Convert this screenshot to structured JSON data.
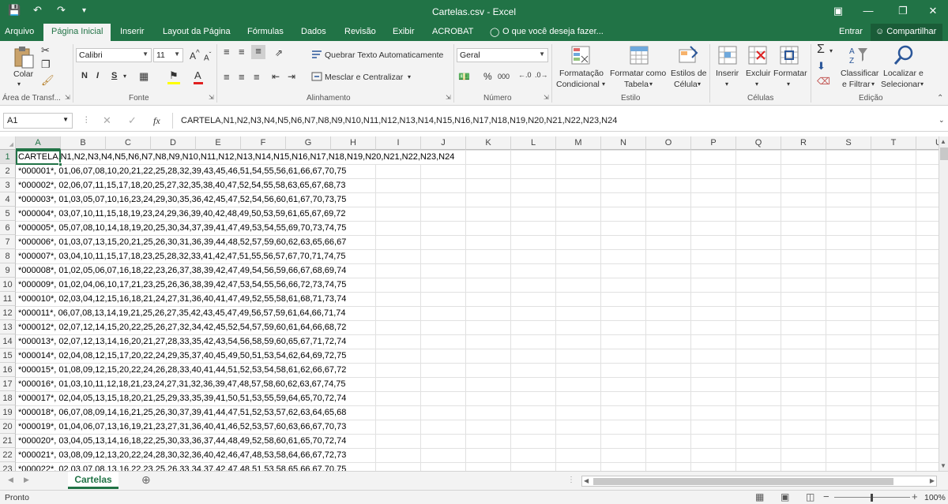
{
  "window": {
    "title": "Cartelas.csv - Excel"
  },
  "tabs": [
    "Arquivo",
    "Página Inicial",
    "Inserir",
    "Layout da Página",
    "Fórmulas",
    "Dados",
    "Revisão",
    "Exibir",
    "ACROBAT"
  ],
  "tell_me": "O que você deseja fazer...",
  "account": {
    "login": "Entrar",
    "share": "Compartilhar"
  },
  "ribbon": {
    "clipboard": {
      "paste": "Colar",
      "group": "Área de Transf..."
    },
    "font": {
      "name": "Calibri",
      "size": "11",
      "group": "Fonte",
      "bold": "N",
      "italic": "I",
      "underline": "S"
    },
    "alignment": {
      "wrap": "Quebrar Texto Automaticamente",
      "merge": "Mesclar e Centralizar",
      "group": "Alinhamento"
    },
    "number": {
      "format": "Geral",
      "group": "Número",
      "percent": "%",
      "thousands": "000"
    },
    "styles": {
      "conditional_1": "Formatação",
      "conditional_2": "Condicional",
      "table_1": "Formatar como",
      "table_2": "Tabela",
      "cell_1": "Estilos de",
      "cell_2": "Célula",
      "group": "Estilo"
    },
    "cells": {
      "insert": "Inserir",
      "delete": "Excluir",
      "format": "Formatar",
      "group": "Células"
    },
    "editing": {
      "sort_1": "Classificar",
      "sort_2": "e Filtrar",
      "find_1": "Localizar e",
      "find_2": "Selecionar",
      "group": "Edição"
    }
  },
  "formula_bar": {
    "name_box": "A1",
    "fx": "fx",
    "content": "CARTELA,N1,N2,N3,N4,N5,N6,N7,N8,N9,N10,N11,N12,N13,N14,N15,N16,N17,N18,N19,N20,N21,N22,N23,N24"
  },
  "columns": [
    "A",
    "B",
    "C",
    "D",
    "E",
    "F",
    "G",
    "H",
    "I",
    "J",
    "K",
    "L",
    "M",
    "N",
    "O",
    "P",
    "Q",
    "R",
    "S",
    "T",
    "U"
  ],
  "rows": [
    {
      "num": "1",
      "text": "CARTELA,N1,N2,N3,N4,N5,N6,N7,N8,N9,N10,N11,N12,N13,N14,N15,N16,N17,N18,N19,N20,N21,N22,N23,N24"
    },
    {
      "num": "2",
      "text": "*000001*, 01,06,07,08,10,20,21,22,25,28,32,39,43,45,46,51,54,55,56,61,66,67,70,75"
    },
    {
      "num": "3",
      "text": "*000002*, 02,06,07,11,15,17,18,20,25,27,32,35,38,40,47,52,54,55,58,63,65,67,68,73"
    },
    {
      "num": "4",
      "text": "*000003*, 01,03,05,07,10,16,23,24,29,30,35,36,42,45,47,52,54,56,60,61,67,70,73,75"
    },
    {
      "num": "5",
      "text": "*000004*, 03,07,10,11,15,18,19,23,24,29,36,39,40,42,48,49,50,53,59,61,65,67,69,72"
    },
    {
      "num": "6",
      "text": "*000005*, 05,07,08,10,14,18,19,20,25,30,34,37,39,41,47,49,53,54,55,69,70,73,74,75"
    },
    {
      "num": "7",
      "text": "*000006*, 01,03,07,13,15,20,21,25,26,30,31,36,39,44,48,52,57,59,60,62,63,65,66,67"
    },
    {
      "num": "8",
      "text": "*000007*, 03,04,10,11,15,17,18,23,25,28,32,33,41,42,47,51,55,56,57,67,70,71,74,75"
    },
    {
      "num": "9",
      "text": "*000008*, 01,02,05,06,07,16,18,22,23,26,37,38,39,42,47,49,54,56,59,66,67,68,69,74"
    },
    {
      "num": "10",
      "text": "*000009*, 01,02,04,06,10,17,21,23,25,26,36,38,39,42,47,53,54,55,56,66,72,73,74,75"
    },
    {
      "num": "11",
      "text": "*000010*, 02,03,04,12,15,16,18,21,24,27,31,36,40,41,47,49,52,55,58,61,68,71,73,74"
    },
    {
      "num": "12",
      "text": "*000011*, 06,07,08,13,14,19,21,25,26,27,35,42,43,45,47,49,56,57,59,61,64,66,71,74"
    },
    {
      "num": "13",
      "text": "*000012*, 02,07,12,14,15,20,22,25,26,27,32,34,42,45,52,54,57,59,60,61,64,66,68,72"
    },
    {
      "num": "14",
      "text": "*000013*, 02,07,12,13,14,16,20,21,27,28,33,35,42,43,54,56,58,59,60,65,67,71,72,74"
    },
    {
      "num": "15",
      "text": "*000014*, 02,04,08,12,15,17,20,22,24,29,35,37,40,45,49,50,51,53,54,62,64,69,72,75"
    },
    {
      "num": "16",
      "text": "*000015*, 01,08,09,12,15,20,22,24,26,28,33,40,41,44,51,52,53,54,58,61,62,66,67,72"
    },
    {
      "num": "17",
      "text": "*000016*, 01,03,10,11,12,18,21,23,24,27,31,32,36,39,47,48,57,58,60,62,63,67,74,75"
    },
    {
      "num": "18",
      "text": "*000017*, 02,04,05,13,15,18,20,21,25,29,33,35,39,41,50,51,53,55,59,64,65,70,72,74"
    },
    {
      "num": "19",
      "text": "*000018*, 06,07,08,09,14,16,21,25,26,30,37,39,41,44,47,51,52,53,57,62,63,64,65,68"
    },
    {
      "num": "20",
      "text": "*000019*, 01,04,06,07,13,16,19,21,23,27,31,36,40,41,46,52,53,57,60,63,66,67,70,73"
    },
    {
      "num": "21",
      "text": "*000020*, 03,04,05,13,14,16,18,22,25,30,33,36,37,44,48,49,52,58,60,61,65,70,72,74"
    },
    {
      "num": "22",
      "text": "*000021*, 03,08,09,12,13,20,22,24,28,30,32,36,40,42,46,47,48,53,58,64,66,67,72,73"
    },
    {
      "num": "23",
      "text": "*000022*, 02,03,07,08,13,16,22,23,25,26,33,34,37,42,47,48,51,53,58,65,66,67,70,75"
    }
  ],
  "sheet": {
    "name": "Cartelas"
  },
  "status": {
    "ready": "Pronto",
    "zoom": "100%"
  }
}
